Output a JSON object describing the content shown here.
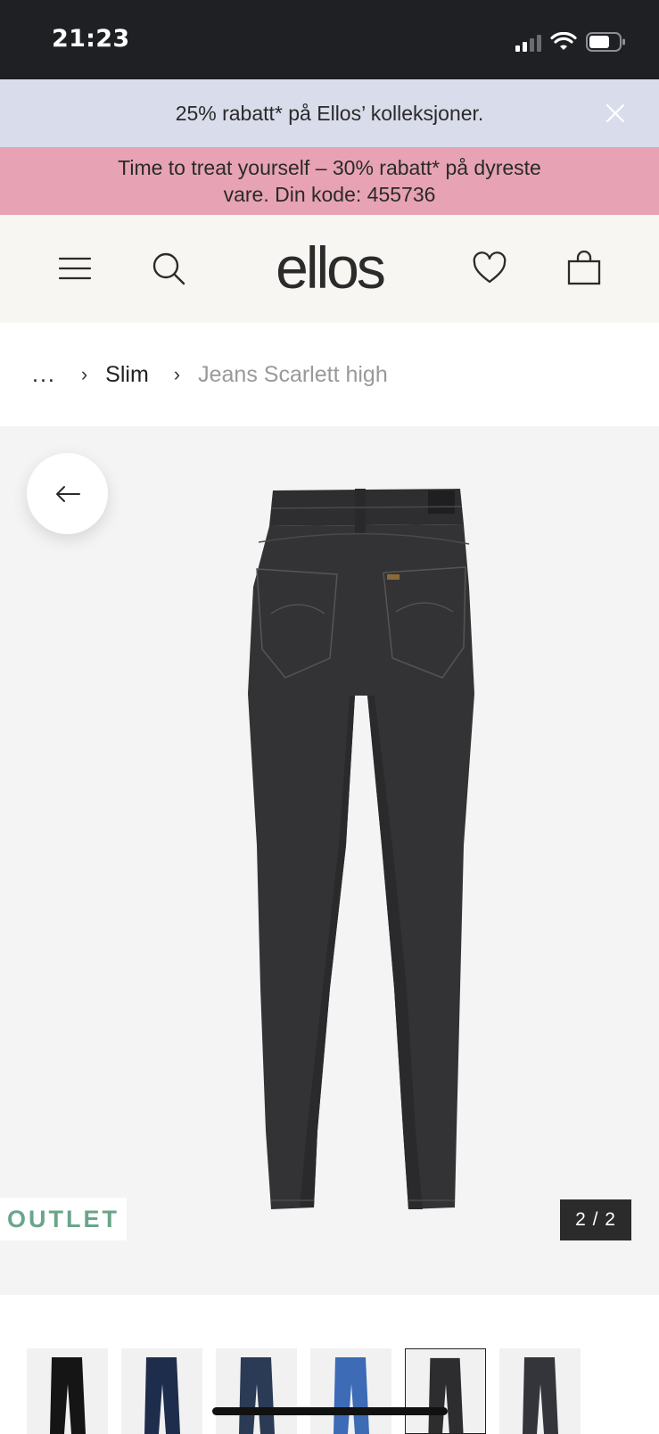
{
  "status_bar": {
    "time": "21:23",
    "battery_percent": 60
  },
  "promo_banners": [
    {
      "text": "25% rabatt* på Ellos’ kolleksjoner.",
      "color": "#d9dcea"
    },
    {
      "line1": "Time to treat yourself – 30% rabatt* på dyreste",
      "line2": "vare. Din kode: 455736",
      "color": "#e7a3b3"
    }
  ],
  "header": {
    "logo": "ellos",
    "icons": [
      "menu-icon",
      "search-icon",
      "heart-icon",
      "bag-icon"
    ]
  },
  "breadcrumb": {
    "more": "...",
    "items": [
      "Slim",
      "Jeans Scarlett high"
    ]
  },
  "gallery": {
    "badge": "OUTLET",
    "counter": "2 / 2",
    "badge_color": "#6aa58a"
  },
  "thumbnails": [
    {
      "color": "black"
    },
    {
      "color": "dark-blue"
    },
    {
      "color": "blue-wash"
    },
    {
      "color": "mid-blue"
    },
    {
      "color": "washed-black",
      "active": true
    },
    {
      "color": "grey-black"
    }
  ]
}
